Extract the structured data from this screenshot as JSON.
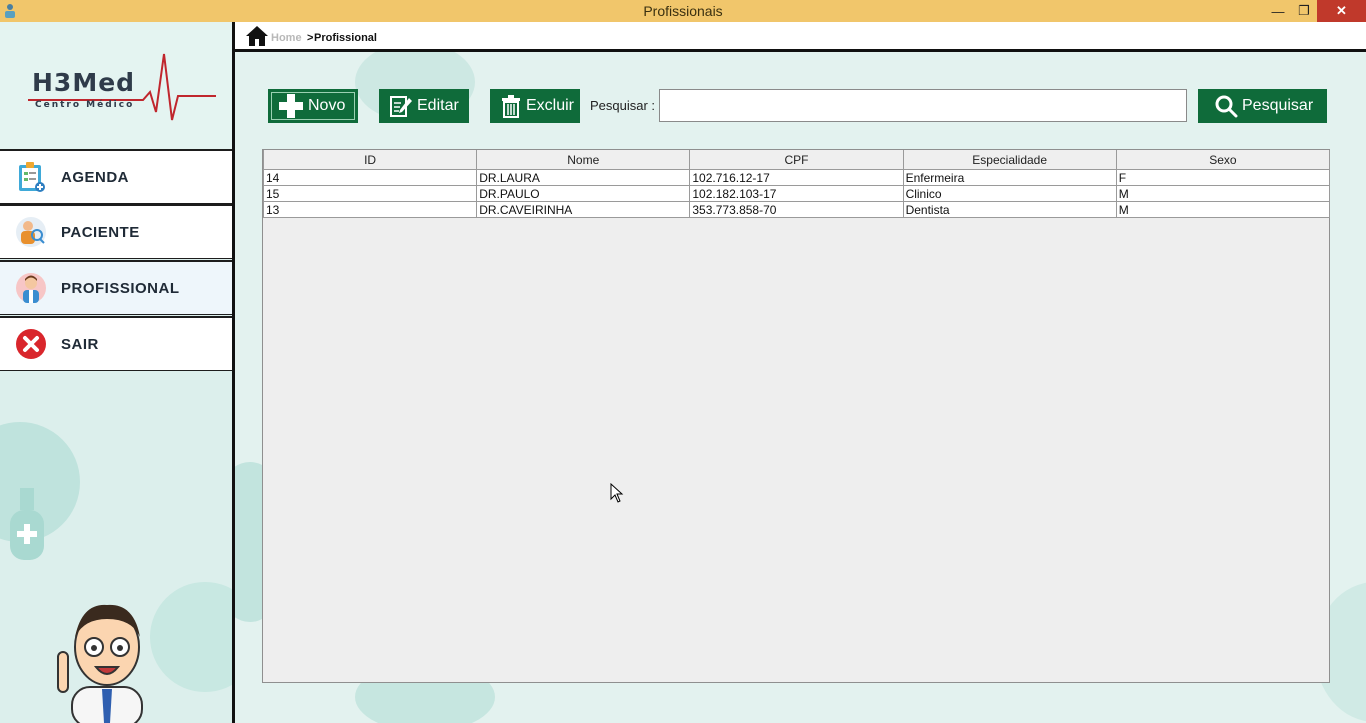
{
  "window": {
    "title": "Profissionais",
    "controls": {
      "minimize": "—",
      "maximize": "❐",
      "close": "✕"
    }
  },
  "sidebar": {
    "logo": {
      "name": "H3Med",
      "subtitle": "Centro Médico"
    },
    "items": [
      {
        "label": "AGENDA",
        "icon": "clipboard-icon"
      },
      {
        "label": "PACIENTE",
        "icon": "patient-icon"
      },
      {
        "label": "PROFISSIONAL",
        "icon": "doctor-icon",
        "active": true
      },
      {
        "label": "SAIR",
        "icon": "exit-icon"
      }
    ]
  },
  "breadcrumb": {
    "home": "Home",
    "separator": ">",
    "current": "Profissional"
  },
  "toolbar": {
    "novo_label": "Novo",
    "editar_label": "Editar",
    "excluir_label": "Excluir",
    "search_label": "Pesquisar :",
    "search_value": "",
    "pesquisar_label": "Pesquisar"
  },
  "table": {
    "columns": [
      "ID",
      "Nome",
      "CPF",
      "Especialidade",
      "Sexo"
    ],
    "rows": [
      [
        "14",
        "DR.LAURA",
        "102.716.12-17",
        "Enfermeira",
        "F"
      ],
      [
        "15",
        "DR.PAULO",
        "102.182.103-17",
        "Clinico",
        "M"
      ],
      [
        "13",
        "DR.CAVEIRINHA",
        "353.773.858-70",
        "Dentista",
        "M"
      ]
    ]
  },
  "colors": {
    "titlebar": "#f1c66b",
    "button_green": "#0f6b3a",
    "logo_red": "#c0262d",
    "close_red": "#c0392b"
  }
}
